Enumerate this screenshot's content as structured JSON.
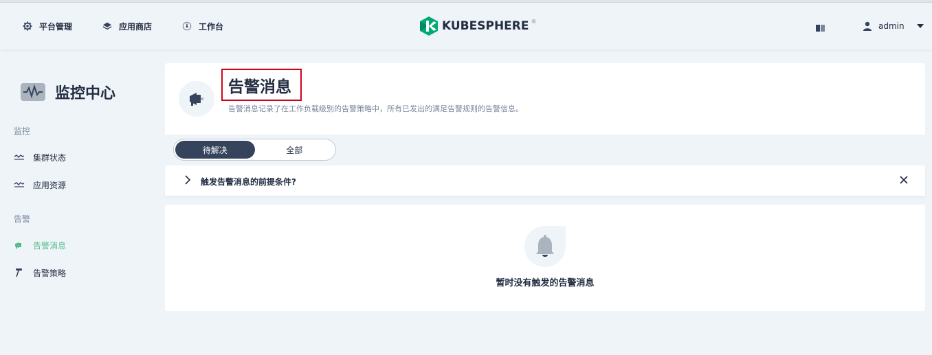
{
  "header": {
    "nav": [
      {
        "label": "平台管理",
        "icon": "gear-icon"
      },
      {
        "label": "应用商店",
        "icon": "layers-icon"
      },
      {
        "label": "工作台",
        "icon": "dashboard-icon"
      }
    ],
    "logo_text": "KUBESPHERE",
    "logo_mark": "®",
    "user_name": "admin"
  },
  "sidebar": {
    "title": "监控中心",
    "groups": [
      {
        "label": "监控",
        "items": [
          {
            "label": "集群状态",
            "icon": "wave-icon"
          },
          {
            "label": "应用资源",
            "icon": "wave-icon"
          }
        ]
      },
      {
        "label": "告警",
        "items": [
          {
            "label": "告警消息",
            "icon": "megaphone-icon",
            "active": true
          },
          {
            "label": "告警策略",
            "icon": "hammer-icon"
          }
        ]
      }
    ]
  },
  "banner": {
    "title": "告警消息",
    "description": "告警消息记录了在工作负载级别的告警策略中，所有已发出的满足告警规则的告警信息。"
  },
  "tabs": [
    {
      "label": "待解决",
      "active": true
    },
    {
      "label": "全部",
      "active": false
    }
  ],
  "tip": {
    "text": "触发告警消息的前提条件?"
  },
  "empty": {
    "text": "暂时没有触发的告警消息"
  },
  "colors": {
    "accent": "#55bc8a",
    "dark": "#36435c",
    "highlight": "#d0021b"
  }
}
